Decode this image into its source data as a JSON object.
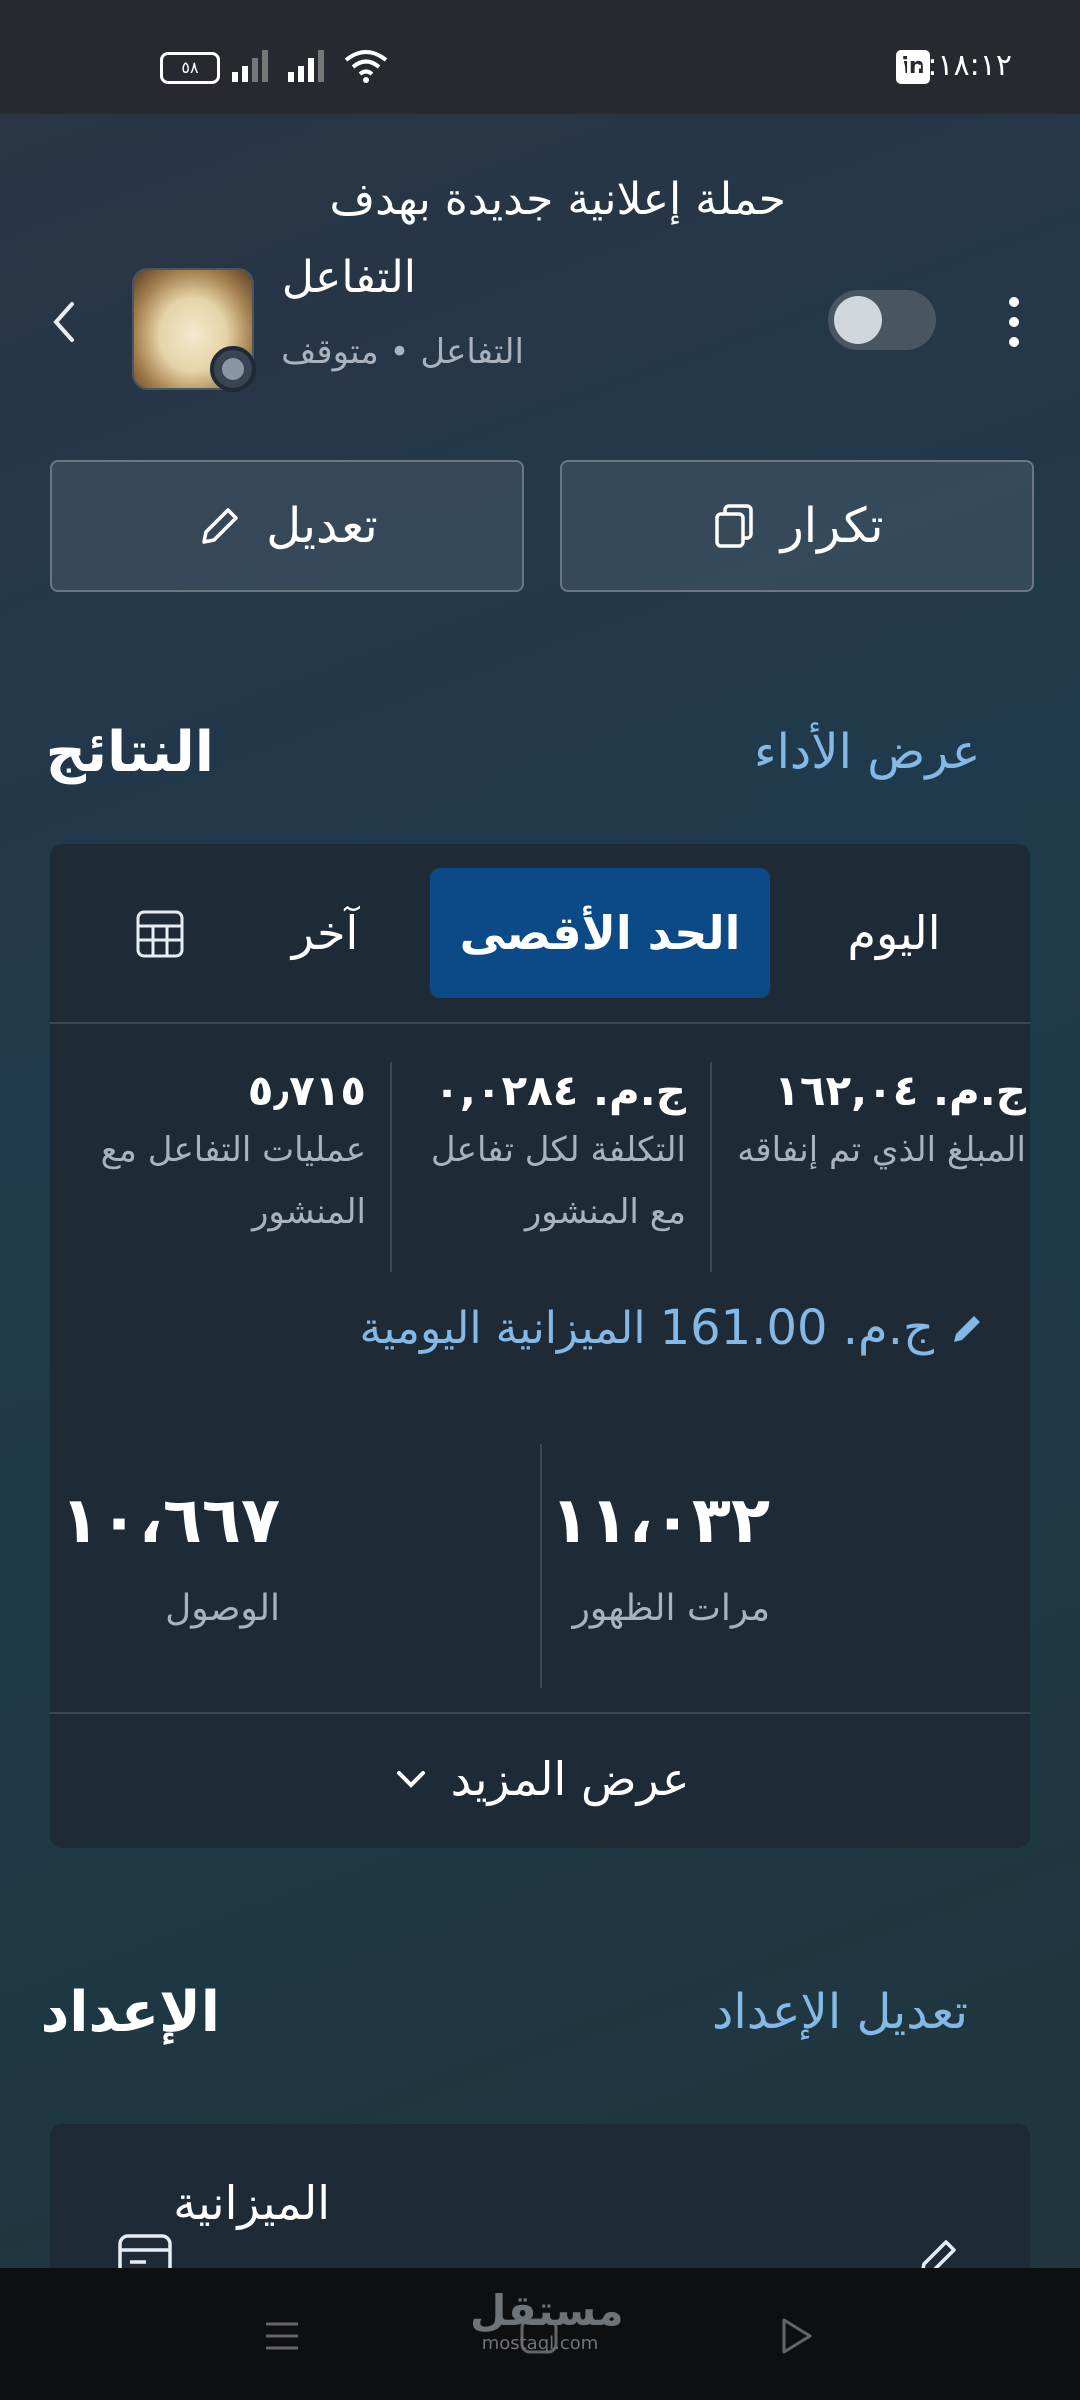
{
  "status_bar": {
    "time": "١٠:١٨:١٢",
    "battery": "٥٨",
    "linkedin_badge": "in"
  },
  "header": {
    "title_line1": "حملة إعلانية جديدة بهدف",
    "title_line2": "التفاعل",
    "subtitle": "التفاعل • متوقف",
    "toggle_on": false
  },
  "actions": {
    "duplicate_label": "تكرار",
    "edit_label": "تعديل"
  },
  "results": {
    "section_title": "النتائج",
    "view_performance_link": "عرض الأداء",
    "tabs": [
      {
        "label": "اليوم",
        "active": false
      },
      {
        "label": "الحد الأقصى",
        "active": true
      },
      {
        "label": "آخر",
        "active": false
      }
    ],
    "metrics": [
      {
        "value": "ج.م. ١٦٢,٠٤",
        "label": "المبلغ الذي تم إنفاقه"
      },
      {
        "value": "ج.م. ٠,٠٢٨٤",
        "label": "التكلفة لكل تفاعل مع المنشور"
      },
      {
        "value": "٥٫٧١٥",
        "label": "عمليات التفاعل مع المنشور"
      }
    ],
    "daily_budget": {
      "amount": "ج.م. 161.00",
      "label": "الميزانية اليومية"
    },
    "big_metrics": [
      {
        "value": "١١،٠٣٢",
        "label": "مرات الظهور"
      },
      {
        "value": "١٠،٦٦٧",
        "label": "الوصول"
      }
    ],
    "show_more_label": "عرض المزيد"
  },
  "setup": {
    "section_title": "الإعداد",
    "edit_link": "تعديل الإعداد",
    "budget_label": "الميزانية"
  },
  "watermark": {
    "arabic": "مستقل",
    "latin": "mostaql.com"
  },
  "colors": {
    "accent_link": "#84b8e6",
    "active_tab": "#0b4a86",
    "card_bg": "#1e2b37"
  }
}
